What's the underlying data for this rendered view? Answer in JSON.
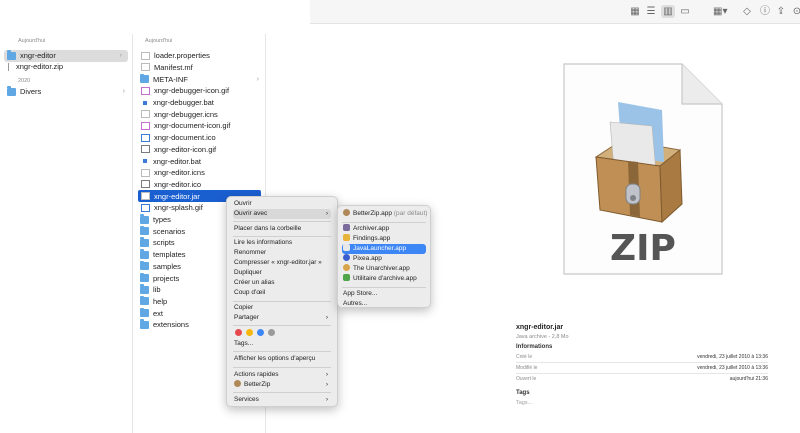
{
  "toolbar": {
    "icons": [
      "grid-view-icon",
      "list-view-icon",
      "column-view-icon",
      "gallery-view-icon",
      "group-icon",
      "tag-icon",
      "info-icon",
      "share-icon",
      "more-icon"
    ]
  },
  "col1": {
    "header_today": "Aujourd'hui",
    "header_2020": "2020",
    "items_today": [
      "xngr-editor",
      "xngr-editor.zip"
    ],
    "items_2020": [
      "Divers"
    ]
  },
  "col2": {
    "header": "Aujourd'hui",
    "items": [
      {
        "label": "loader.properties",
        "kind": "file"
      },
      {
        "label": "Manifest.mf",
        "kind": "file"
      },
      {
        "label": "META-INF",
        "kind": "folder"
      },
      {
        "label": "xngr-debugger-icon.gif",
        "kind": "file"
      },
      {
        "label": "xngr-debugger.bat",
        "kind": "file"
      },
      {
        "label": "xngr-debugger.icns",
        "kind": "file"
      },
      {
        "label": "xngr-document-icon.gif",
        "kind": "file"
      },
      {
        "label": "xngr-document.ico",
        "kind": "file"
      },
      {
        "label": "xngr-editor-icon.gif",
        "kind": "file"
      },
      {
        "label": "xngr-editor.bat",
        "kind": "file"
      },
      {
        "label": "xngr-editor.icns",
        "kind": "file"
      },
      {
        "label": "xngr-editor.ico",
        "kind": "file"
      },
      {
        "label": "xngr-editor.jar",
        "kind": "file"
      },
      {
        "label": "xngr-splash.gif",
        "kind": "file"
      },
      {
        "label": "types",
        "kind": "folder"
      },
      {
        "label": "scenarios",
        "kind": "folder"
      },
      {
        "label": "scripts",
        "kind": "folder"
      },
      {
        "label": "templates",
        "kind": "folder"
      },
      {
        "label": "samples",
        "kind": "folder"
      },
      {
        "label": "projects",
        "kind": "folder"
      },
      {
        "label": "lib",
        "kind": "folder"
      },
      {
        "label": "help",
        "kind": "folder"
      },
      {
        "label": "ext",
        "kind": "folder"
      },
      {
        "label": "extensions",
        "kind": "folder"
      }
    ]
  },
  "context_menu": {
    "open": "Ouvrir",
    "open_with": "Ouvrir avec",
    "trash": "Placer dans la corbeille",
    "get_info": "Lire les informations",
    "rename": "Renommer",
    "compress": "Compresser « xngr-editor.jar »",
    "duplicate": "Dupliquer",
    "alias": "Créer un alias",
    "quicklook": "Coup d'œil",
    "copy": "Copier",
    "share": "Partager",
    "tags": "Tags...",
    "preview_options": "Afficher les options d'aperçu",
    "quick_actions": "Actions rapides",
    "betterzip": "BetterZip",
    "services": "Services",
    "tag_colors": [
      "#e5484d",
      "#f5b70a",
      "#3d86f5",
      "#9a9a9a"
    ]
  },
  "submenu": {
    "default_app": "BetterZip.app",
    "default_suffix": "(par défaut)",
    "apps": [
      "Archiver.app",
      "Findings.app",
      "JavaLauncher.app",
      "Pixea.app",
      "The Unarchiver.app",
      "Utilitaire d'archive.app"
    ],
    "app_store": "App Store...",
    "other": "Autres..."
  },
  "preview": {
    "icon_label": "ZIP",
    "filename": "xngr-editor.jar",
    "kind": "Java archive - 2,8 Mo",
    "info_title": "Informations",
    "created_label": "Créé le",
    "created_value": "vendredi, 23 juillet 2010 à 13:36",
    "modified_label": "Modifié le",
    "modified_value": "vendredi, 23 juillet 2010 à 13:36",
    "opened_label": "Ouvert le",
    "opened_value": "aujourd'hui 21:36",
    "tags_title": "Tags",
    "tags_placeholder": "Tags..."
  }
}
